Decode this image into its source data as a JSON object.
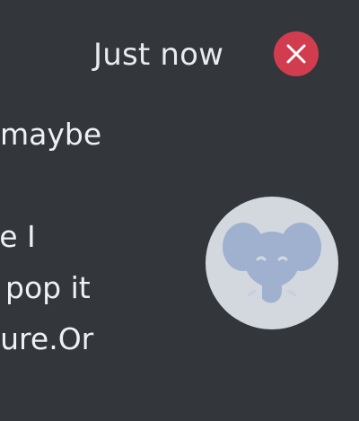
{
  "notification": {
    "timestamp": "Just now",
    "message_lines": [
      "maybe",
      "",
      "se I",
      "pop it",
      "cure.Or"
    ],
    "close_icon": "close-icon",
    "avatar_icon": "elephant-icon",
    "colors": {
      "background": "#33363b",
      "close_button": "#d23c4f",
      "avatar_background": "#d3d8df",
      "avatar_figure": "#9fb1cf"
    }
  }
}
